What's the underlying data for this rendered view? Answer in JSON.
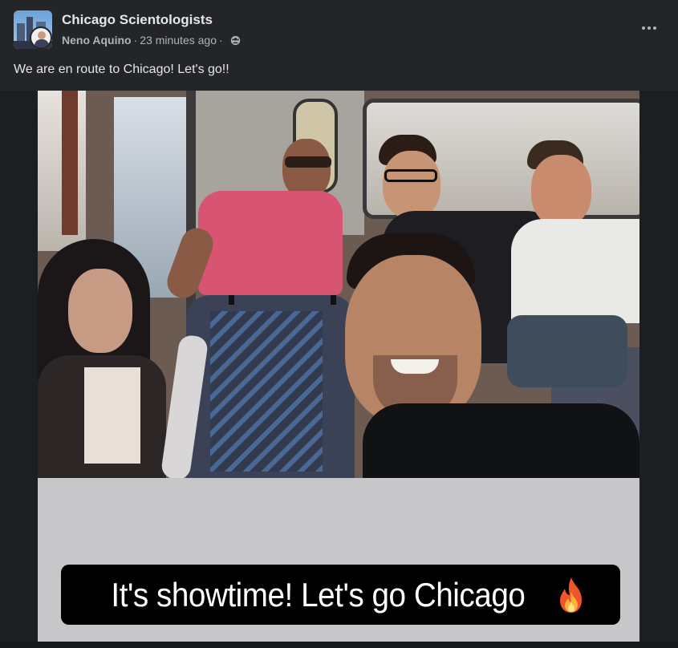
{
  "post": {
    "group_name": "Chicago Scientologists",
    "author": "Neno Aquino",
    "separator": "·",
    "time": "23 minutes ago",
    "privacy_icon": "group-members-icon",
    "more_icon": "more-options-icon",
    "caption": "We are en route to Chicago! Let's go!!",
    "media": {
      "description_icon": "photo",
      "overlay_text": "It's showtime! Let's go Chicago",
      "overlay_emoji_icon": "fire-emoji-icon"
    }
  }
}
